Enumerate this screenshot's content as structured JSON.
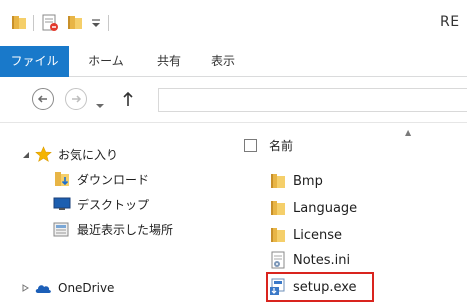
{
  "window": {
    "title": "RE"
  },
  "ribbon": {
    "tabs": [
      {
        "label": "ファイル",
        "active": true
      },
      {
        "label": "ホーム",
        "active": false
      },
      {
        "label": "共有",
        "active": false
      },
      {
        "label": "表示",
        "active": false
      }
    ]
  },
  "nav_buttons": {
    "back": "back-arrow-icon",
    "forward": "forward-arrow-icon",
    "recent": "chevron-down-icon",
    "up": "up-arrow-icon"
  },
  "navpane": {
    "items": [
      {
        "label": "お気に入り",
        "icon": "star-icon"
      },
      {
        "label": "ダウンロード",
        "icon": "downloads-folder-icon"
      },
      {
        "label": "デスクトップ",
        "icon": "desktop-icon"
      },
      {
        "label": "最近表示した場所",
        "icon": "recent-places-icon"
      },
      {
        "label": "OneDrive",
        "icon": "cloud-icon"
      }
    ]
  },
  "filelist": {
    "column_header": "名前",
    "files": [
      {
        "name": "Bmp",
        "type": "folder"
      },
      {
        "name": "Language",
        "type": "folder"
      },
      {
        "name": "License",
        "type": "folder"
      },
      {
        "name": "Notes.ini",
        "type": "ini"
      },
      {
        "name": "setup.exe",
        "type": "exe",
        "highlighted": true
      }
    ]
  },
  "colors": {
    "accent": "#1979ca",
    "highlight_border": "#d9241e",
    "folder": "#e8b546"
  }
}
